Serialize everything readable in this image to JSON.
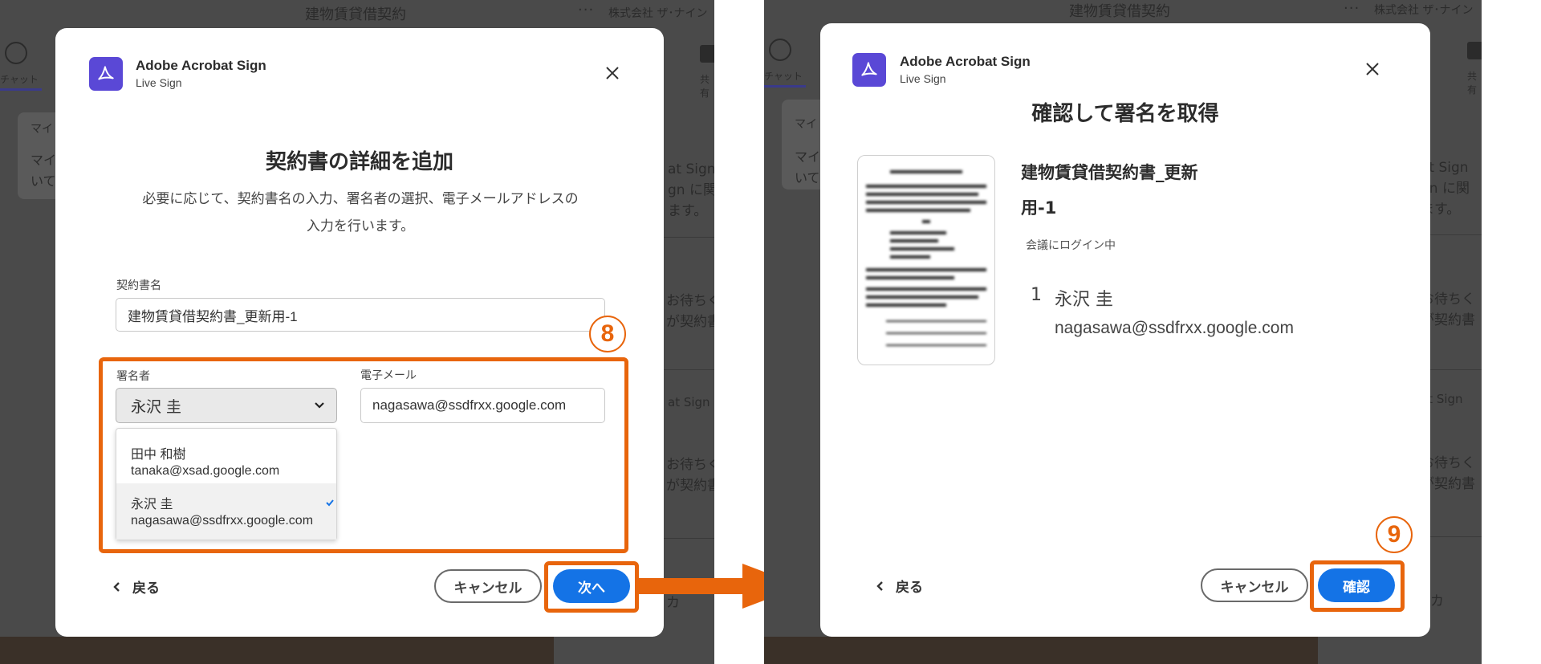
{
  "background": {
    "app_title": "建物賃貸借契約",
    "more": "···",
    "company": "株式会社 ザ･ナイン",
    "chat_label": "チャット",
    "share_label": "共有",
    "left_card_line1": "マイ",
    "left_card_line2": "マイ",
    "left_card_line3": "いて",
    "side_texts": [
      "at Sign",
      "gn に関",
      "ます。",
      "at Sign",
      "お待ちく",
      "が契約書",
      "at Sign",
      "お待ちく",
      "が契約書",
      "カ"
    ]
  },
  "left_dialog": {
    "brand_name": "Adobe Acrobat Sign",
    "brand_sub": "Live Sign",
    "title": "契約書の詳細を追加",
    "subtitle_line1": "必要に応じて、契約書名の入力、署名者の選択、電子メールアドレスの",
    "subtitle_line2": "入力を行います。",
    "agreement_label": "契約書名",
    "agreement_value": "建物賃貸借契約書_更新用-1",
    "signer_label": "署名者",
    "signer_selected": "永沢 圭",
    "email_label": "電子メール",
    "email_value": "nagasawa@ssdfrxx.google.com",
    "options": [
      {
        "name": "田中 和樹",
        "email": "tanaka@xsad.google.com",
        "selected": false
      },
      {
        "name": "永沢 圭",
        "email": "nagasawa@ssdfrxx.google.com",
        "selected": true
      }
    ],
    "back_label": "戻る",
    "cancel_label": "キャンセル",
    "next_label": "次へ",
    "step_number": "8"
  },
  "right_dialog": {
    "brand_name": "Adobe Acrobat Sign",
    "brand_sub": "Live Sign",
    "title": "確認して署名を取得",
    "doc_name_line1": "建物賃貸借契約書_更新",
    "doc_name_line2": "用-1",
    "status": "会議にログイン中",
    "signer_index": "1",
    "signer_name": "永沢 圭",
    "signer_email": "nagasawa@ssdfrxx.google.com",
    "back_label": "戻る",
    "cancel_label": "キャンセル",
    "confirm_label": "確認",
    "step_number": "9"
  },
  "colors": {
    "highlight": "#e8650c",
    "primary_button": "#1473e6",
    "logo": "#5a48d6"
  }
}
